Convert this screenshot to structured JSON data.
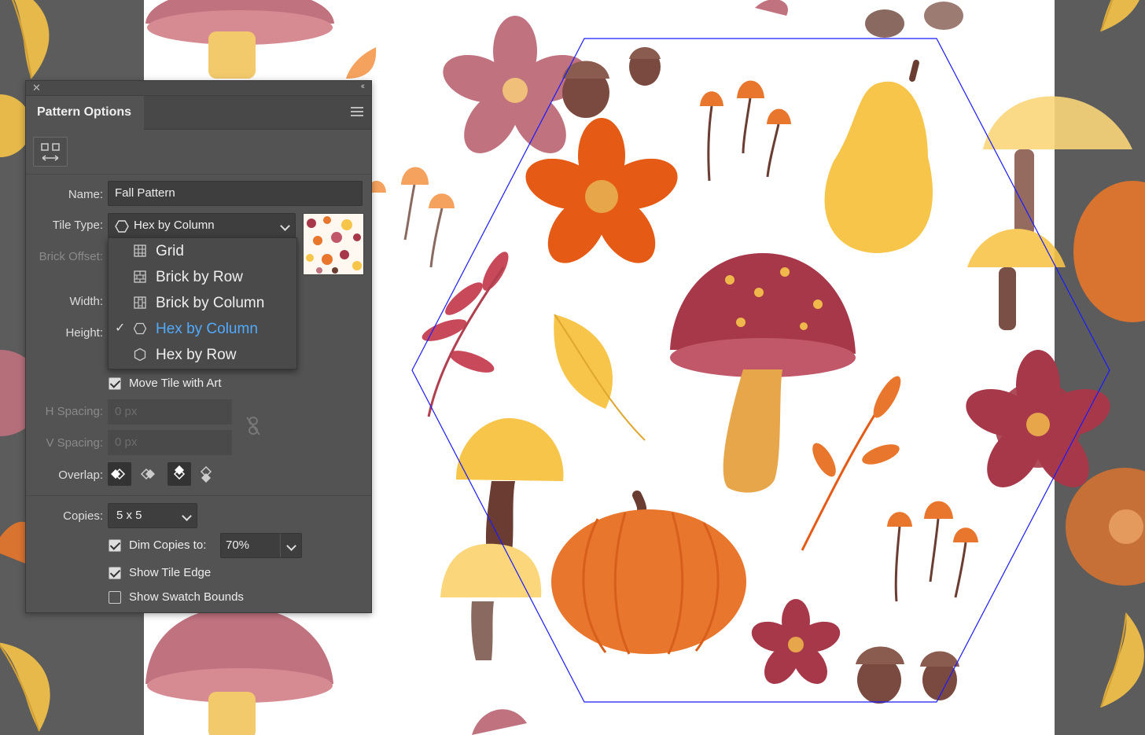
{
  "panel": {
    "title": "Pattern Options",
    "name_label": "Name:",
    "name_value": "Fall Pattern",
    "tile_type_label": "Tile Type:",
    "tile_type_value": "Hex by Column",
    "brick_offset_label": "Brick Offset:",
    "width_label": "Width:",
    "height_label": "Height:",
    "move_tile_label": "Move Tile with Art",
    "h_spacing_label": "H Spacing:",
    "h_spacing_value": "0 px",
    "v_spacing_label": "V Spacing:",
    "v_spacing_value": "0 px",
    "overlap_label": "Overlap:",
    "copies_label": "Copies:",
    "copies_value": "5 x 5",
    "dim_copies_label": "Dim Copies to:",
    "dim_copies_value": "70%",
    "show_tile_edge_label": "Show Tile Edge",
    "show_swatch_bounds_label": "Show Swatch Bounds"
  },
  "tile_menu": {
    "items": [
      {
        "label": "Grid",
        "icon": "grid-icon"
      },
      {
        "label": "Brick by Row",
        "icon": "brick-row-icon"
      },
      {
        "label": "Brick by Column",
        "icon": "brick-column-icon"
      },
      {
        "label": "Hex by Column",
        "icon": "hex-column-icon",
        "selected": true
      },
      {
        "label": "Hex by Row",
        "icon": "hex-row-icon"
      }
    ]
  },
  "colors": {
    "accent": "#52aaff",
    "tile_edge": "#1a1aff",
    "pumpkin": "#e8762c",
    "mushroom_red": "#a6384a",
    "yellow": "#f6c549",
    "plum": "#c0727f"
  }
}
